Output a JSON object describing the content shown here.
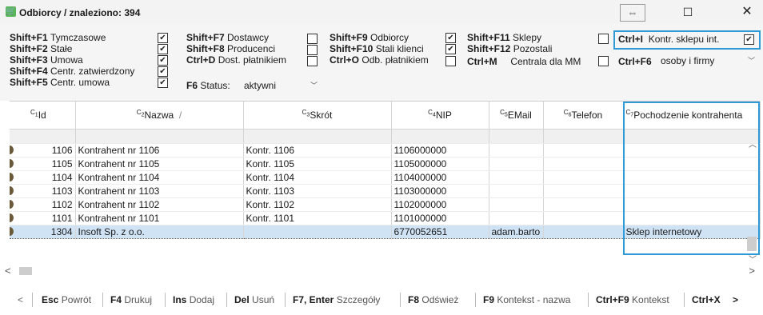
{
  "window": {
    "title": "Odbiorcy / znaleziono: 394",
    "restore_glyph": "⇔",
    "maximize_glyph": "☐",
    "close_glyph": "✕"
  },
  "filters": {
    "col1": [
      {
        "key": "Shift+F1",
        "label": "Tymczasowe",
        "checked": true
      },
      {
        "key": "Shift+F2",
        "label": "Stałe",
        "checked": true
      },
      {
        "key": "Shift+F3",
        "label": "Umowa",
        "checked": true
      },
      {
        "key": "Shift+F4",
        "label": "Centr. zatwierdzony",
        "checked": true
      },
      {
        "key": "Shift+F5",
        "label": "Centr. umowa",
        "checked": true
      }
    ],
    "col2": [
      {
        "key": "Shift+F7",
        "label": "Dostawcy",
        "checked": false
      },
      {
        "key": "Shift+F8",
        "label": "Producenci",
        "checked": false
      },
      {
        "key": "Ctrl+D",
        "label": "Dost. płatnikiem",
        "checked": false
      }
    ],
    "col3": [
      {
        "key": "Shift+F9",
        "label": "Odbiorcy",
        "checked": true
      },
      {
        "key": "Shift+F10",
        "label": "Stali klienci",
        "checked": true
      },
      {
        "key": "Ctrl+O",
        "label": "Odb. płatnikiem",
        "checked": false
      }
    ],
    "col4": [
      {
        "key": "Shift+F11",
        "label": "Sklepy",
        "checked": false
      },
      {
        "key": "Shift+F12",
        "label": "Pozostali",
        "checked": false
      },
      {
        "key": "Ctrl+M",
        "label": "Centrala dla MM",
        "checked": false
      }
    ],
    "status": {
      "key": "F6",
      "label": "Status:",
      "value": "aktywni"
    },
    "ctrl_i": {
      "key": "Ctrl+I",
      "label": "Kontr. sklepu int.",
      "checked": true
    },
    "ctrl_f6": {
      "key": "Ctrl+F6",
      "value": "osoby i firmy"
    }
  },
  "grid": {
    "columns": [
      {
        "ctrl": "1",
        "label": "Id"
      },
      {
        "ctrl": "2",
        "label": "Nazwa",
        "sort": "/"
      },
      {
        "ctrl": "3",
        "label": "Skrót"
      },
      {
        "ctrl": "4",
        "label": "NIP"
      },
      {
        "ctrl": "5",
        "label": "EMail"
      },
      {
        "ctrl": "6",
        "label": "Telefon"
      },
      {
        "ctrl": "7",
        "label": "Pochodzenie kontrahenta"
      }
    ],
    "rows": [
      {
        "id": "1106",
        "nazwa": "Kontrahent nr 1106",
        "skrot": "Kontr. 1106",
        "nip": "1106000000",
        "email": "",
        "telefon": "",
        "pochodzenie": ""
      },
      {
        "id": "1105",
        "nazwa": "Kontrahent nr 1105",
        "skrot": "Kontr. 1105",
        "nip": "1105000000",
        "email": "",
        "telefon": "",
        "pochodzenie": ""
      },
      {
        "id": "1104",
        "nazwa": "Kontrahent nr 1104",
        "skrot": "Kontr. 1104",
        "nip": "1104000000",
        "email": "",
        "telefon": "",
        "pochodzenie": ""
      },
      {
        "id": "1103",
        "nazwa": "Kontrahent nr 1103",
        "skrot": "Kontr. 1103",
        "nip": "1103000000",
        "email": "",
        "telefon": "",
        "pochodzenie": ""
      },
      {
        "id": "1102",
        "nazwa": "Kontrahent nr 1102",
        "skrot": "Kontr. 1102",
        "nip": "1102000000",
        "email": "",
        "telefon": "",
        "pochodzenie": ""
      },
      {
        "id": "1101",
        "nazwa": "Kontrahent nr 1101",
        "skrot": "Kontr. 1101",
        "nip": "1101000000",
        "email": "",
        "telefon": "",
        "pochodzenie": ""
      },
      {
        "id": "1304",
        "nazwa": "Insoft Sp. z o.o.",
        "skrot": "",
        "nip": "6770052651",
        "email": "adam.barto",
        "telefon": "",
        "pochodzenie": "Sklep internetowy",
        "selected": true
      }
    ]
  },
  "bottom": [
    {
      "key": "Esc",
      "label": "Powrót"
    },
    {
      "key": "F4",
      "label": "Drukuj"
    },
    {
      "key": "Ins",
      "label": "Dodaj"
    },
    {
      "key": "Del",
      "label": "Usuń"
    },
    {
      "key": "F7, Enter",
      "label": "Szczegóły"
    },
    {
      "key": "F8",
      "label": "Odśwież"
    },
    {
      "key": "F9",
      "label": "Kontekst - nazwa"
    },
    {
      "key": "Ctrl+F9",
      "label": "Kontekst"
    },
    {
      "key": "Ctrl+X",
      "label": ""
    }
  ],
  "colors": {
    "highlight": "#2f9ad6",
    "selected_row": "#cfe3f5"
  }
}
